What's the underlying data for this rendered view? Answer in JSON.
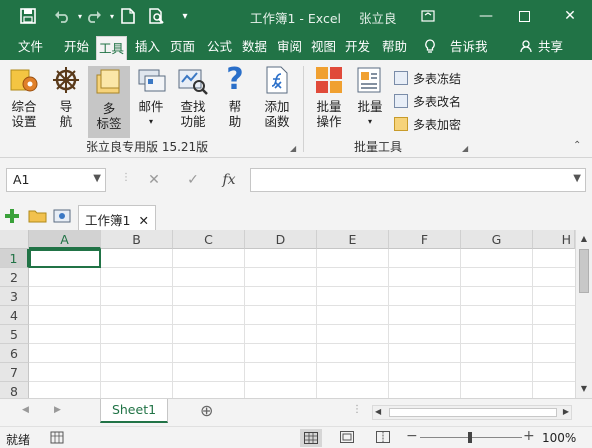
{
  "titlebar": {
    "title": "工作簿1 - Excel",
    "user": "张立良",
    "save_icon": "save-icon",
    "undo_icon": "undo-icon",
    "redo_icon": "redo-icon",
    "new_icon": "new-file-icon",
    "preview_icon": "print-preview-icon",
    "customize_icon": "customize-qat-icon"
  },
  "menu": {
    "tabs": [
      "文件",
      "开始",
      "工具",
      "插入",
      "页面",
      "公式",
      "数据",
      "审阅",
      "视图",
      "开发",
      "帮助"
    ],
    "active_tab": "工具",
    "tell_me": "告诉我",
    "share": "共享"
  },
  "ribbon": {
    "buttons": [
      {
        "label1": "综合",
        "label2": "设置"
      },
      {
        "label1": "导",
        "label2": "航"
      },
      {
        "label1": "多",
        "label2": "标签"
      },
      {
        "label1": "邮件",
        "label2": ""
      },
      {
        "label1": "查找",
        "label2": "功能"
      },
      {
        "label1": "帮",
        "label2": "助"
      },
      {
        "label1": "添加",
        "label2": "函数"
      },
      {
        "label1": "批量",
        "label2": "操作"
      },
      {
        "label1": "批量",
        "label2": ""
      }
    ],
    "small_buttons": [
      "多表冻结",
      "多表改名",
      "多表加密"
    ],
    "group1_label": "张立良专用版 15.21版",
    "group2_label": "批量工具"
  },
  "formula": {
    "namebox": "A1",
    "cancel": "✕",
    "enter": "✓",
    "fx": "fx",
    "value": ""
  },
  "workbook_tab": {
    "label": "工作簿1",
    "close": "✕"
  },
  "grid": {
    "columns": [
      "A",
      "B",
      "C",
      "D",
      "E",
      "F",
      "G",
      "H"
    ],
    "rows": [
      "1",
      "2",
      "3",
      "4",
      "5",
      "6",
      "7",
      "8"
    ],
    "active_cell": "A1"
  },
  "sheets": {
    "tabs": [
      "Sheet1"
    ],
    "active": "Sheet1",
    "add_label": "⊕"
  },
  "status": {
    "ready": "就绪",
    "zoom": "100%"
  },
  "colors": {
    "accent": "#217346",
    "ribbon_bg": "#f3f3f3"
  }
}
